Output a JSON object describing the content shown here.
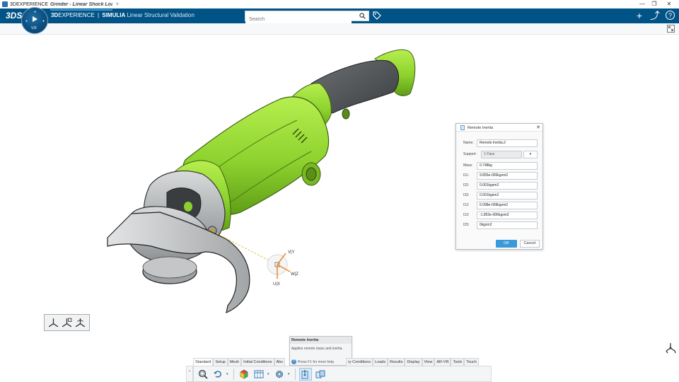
{
  "os": {
    "window_title": "3DEXPERIENCE",
    "minimize_glyph": "—",
    "restore_glyph": "❐",
    "close_glyph": "✕"
  },
  "topbar": {
    "ds_logo": "3DS",
    "brand_prefix": "3D",
    "brand_main": "EXPERIENCE",
    "brand_sep": "|",
    "brand_company": "SIMULIA",
    "app_name": "Linear Structural Validation",
    "search_placeholder": "Search",
    "icons": [
      "search-icon",
      "tag-icon",
      "add-icon",
      "share-icon",
      "help-icon"
    ],
    "add_glyph": "+",
    "share_glyph": "⤴",
    "help_glyph": "?"
  },
  "compass": {
    "label": "V,R"
  },
  "tabs": {
    "active_tab": "Grinder - Linear Shock Loa",
    "add_glyph": "+"
  },
  "dialog": {
    "title": "Remote Inertia",
    "close_glyph": "✕",
    "fields": [
      {
        "label": "Name:",
        "value": "Remote Inertia.2"
      },
      {
        "label": "Support:",
        "value": "1 Face"
      },
      {
        "label": "Mass:",
        "value": "0.748kg"
      },
      {
        "label": "I11:",
        "value": "9.855e-005kgxm2"
      },
      {
        "label": "I22:",
        "value": "0.001kgxm2"
      },
      {
        "label": "I33:",
        "value": "0.001kgxm2"
      },
      {
        "label": "I12:",
        "value": "6.098e-009kgxm2"
      },
      {
        "label": "I13:",
        "value": "-1.853e-006kgxm2"
      },
      {
        "label": "I23:",
        "value": "0kgxm2"
      }
    ],
    "support_select": "▾",
    "ok_label": "OK",
    "cancel_label": "Cancel"
  },
  "triad": {
    "v_label": "V|Y",
    "w_label": "W|Z",
    "u_label": "U|X"
  },
  "tooltip": {
    "title": "Remote Inertia",
    "description": "Applies remote mass and inertia.",
    "help": "Press F1 for more help."
  },
  "action_bar": {
    "tabs": [
      "Standard",
      "Setup",
      "Mesh",
      "Initial Conditions",
      "Abs",
      "ry Conditions",
      "Loads",
      "Results",
      "Display",
      "View",
      "AR-VR",
      "Tools",
      "Touch"
    ],
    "active_tab": "Standard",
    "collapse_glyph": "⌄",
    "tools": [
      "zoom-fit-icon",
      "undo-icon",
      "material-icon",
      "table-icon",
      "settings-gear-icon",
      "remote-inertia-icon",
      "remote-mass-icon"
    ]
  },
  "axis_bar": {
    "icons": [
      "axis-triad-icon",
      "axis-frame-icon",
      "axis-orientation-icon"
    ]
  },
  "colors": {
    "topbar": "#005386",
    "accent": "#3a9ad9",
    "model_green": "#8bd12d",
    "model_grey": "#b9bcbe",
    "handle_dark": "#4a4d50"
  }
}
